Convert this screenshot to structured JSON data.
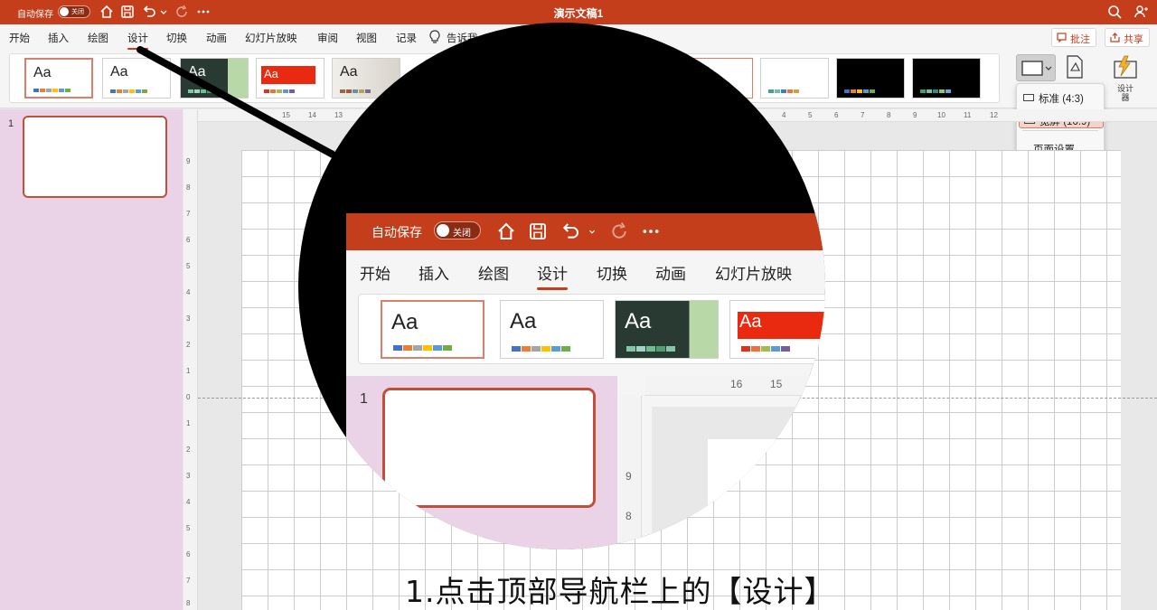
{
  "titlebar": {
    "autosave_label": "自动保存",
    "toggle_label": "关闭",
    "title": "演示文稿1"
  },
  "menu": {
    "items": [
      "开始",
      "插入",
      "绘图",
      "设计",
      "切换",
      "动画",
      "幻灯片放映",
      "审阅",
      "视图",
      "记录"
    ],
    "active": "设计",
    "tip": "告诉我",
    "comment_label": "批注",
    "share_label": "共享"
  },
  "ribbon": {
    "design_label": "设计\n器"
  },
  "dropdown": {
    "items": [
      "标准 (4:3)",
      "宽屏 (16:9)",
      "页面设置..."
    ],
    "highlighted": "宽屏 (16:9)"
  },
  "slides": {
    "first_number": "1"
  },
  "rulers": {
    "h_labels": [
      "15",
      "14",
      "13",
      "4",
      "5",
      "6",
      "7",
      "8",
      "9",
      "10",
      "11",
      "12"
    ],
    "v_labels": [
      "9",
      "8",
      "7",
      "6",
      "5",
      "4",
      "3",
      "2",
      "1",
      "0",
      "1",
      "2",
      "3",
      "4",
      "5",
      "6",
      "7",
      "8"
    ]
  },
  "magnifier": {
    "autosave_label": "自动保存",
    "toggle_label": "关闭",
    "menu_items": [
      "开始",
      "插入",
      "绘图",
      "设计",
      "切换",
      "动画",
      "幻灯片放映"
    ],
    "slide_number": "1",
    "ruler_h": [
      "16",
      "15"
    ],
    "ruler_v": [
      "9",
      "8"
    ]
  },
  "caption": "1.点击顶部导航栏上的【设计】",
  "colors": {
    "accent": "#c43e1c",
    "panel": "#ead3e6",
    "highlight": "#f5d3c9"
  }
}
